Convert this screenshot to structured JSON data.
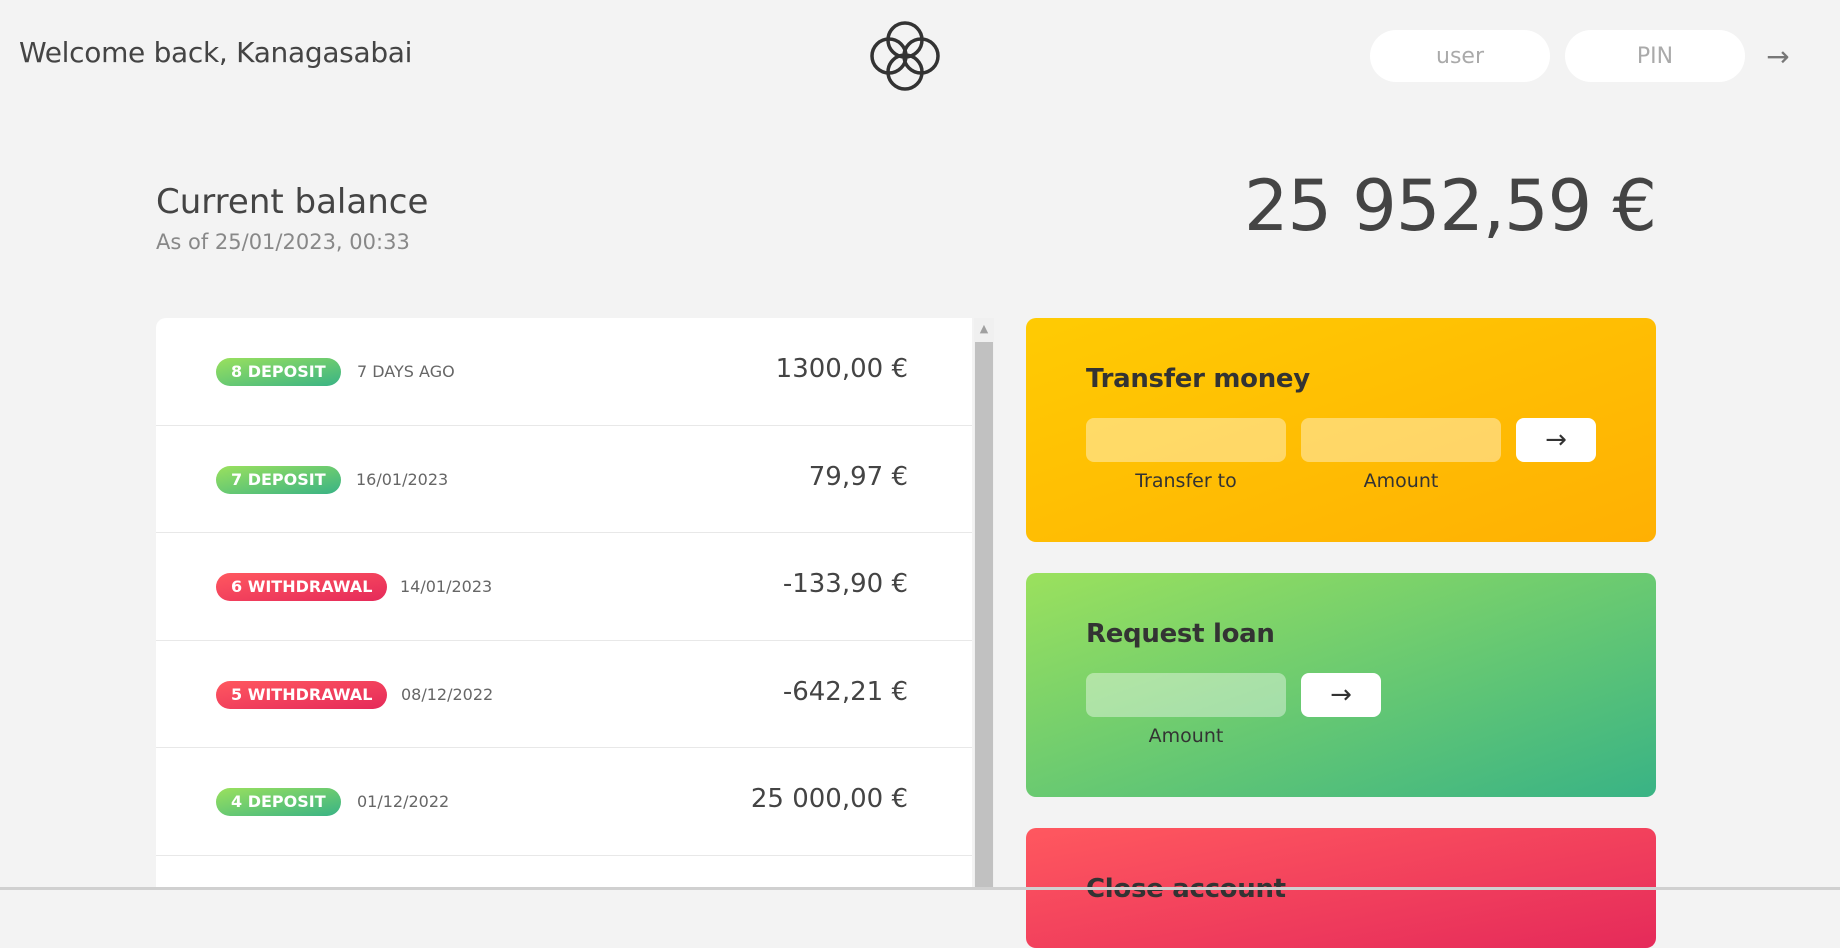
{
  "nav": {
    "welcome": "Welcome back, Kanagasabai",
    "login_user_placeholder": "user",
    "login_pin_placeholder": "PIN",
    "login_button": "→"
  },
  "balance": {
    "label": "Current balance",
    "date": "As of 25/01/2023, 00:33",
    "value": "25 952,59 €"
  },
  "movements": [
    {
      "type_label": "8 deposit",
      "kind": "deposit",
      "date": "7 days ago",
      "value": "1300,00 €"
    },
    {
      "type_label": "7 deposit",
      "kind": "deposit",
      "date": "16/01/2023",
      "value": "79,97 €"
    },
    {
      "type_label": "6 withdrawal",
      "kind": "withdrawal",
      "date": "14/01/2023",
      "value": "-133,90 €"
    },
    {
      "type_label": "5 withdrawal",
      "kind": "withdrawal",
      "date": "08/12/2022",
      "value": "-642,21 €"
    },
    {
      "type_label": "4 deposit",
      "kind": "deposit",
      "date": "01/12/2022",
      "value": "25 000,00 €"
    }
  ],
  "transfer": {
    "title": "Transfer money",
    "to_label": "Transfer to",
    "amount_label": "Amount",
    "button": "→"
  },
  "loan": {
    "title": "Request loan",
    "amount_label": "Amount",
    "button": "→"
  },
  "close": {
    "title": "Close account"
  },
  "colors": {
    "deposit_start": "#9be15d",
    "deposit_end": "#39b385",
    "withdrawal_start": "#ff585f",
    "withdrawal_end": "#e52a5a",
    "transfer_start": "#ffcb03",
    "transfer_end": "#ffb003"
  }
}
